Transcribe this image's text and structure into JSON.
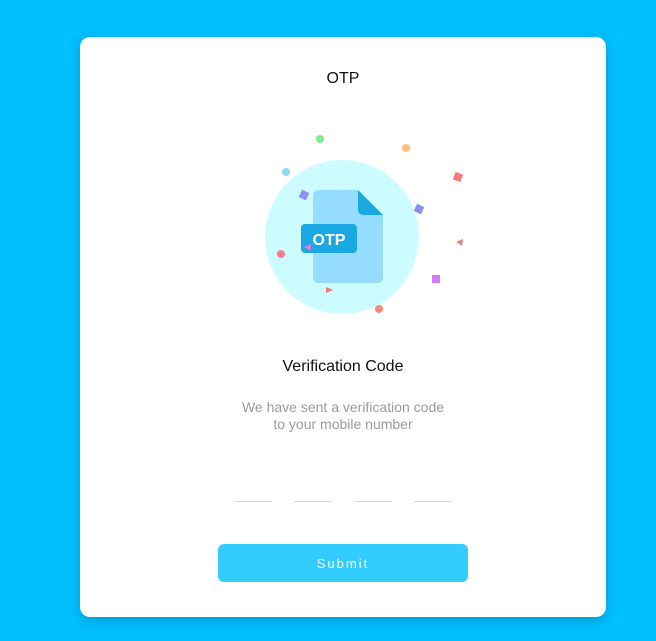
{
  "card": {
    "title": "OTP"
  },
  "illustration": {
    "badge_text": "OTP",
    "icons": [
      "otp-document-icon",
      "confetti-decoration"
    ],
    "colors": {
      "circle": "#ccfcff",
      "document": "#96dcff",
      "document_fold": "#19a9e0",
      "badge": "#19a9e0"
    }
  },
  "verification": {
    "heading": "Verification Code",
    "line1": "We have sent a verification code",
    "line2": "to your mobile number"
  },
  "otp": {
    "digit1": "",
    "digit2": "",
    "digit3": "",
    "digit4": ""
  },
  "actions": {
    "submit_label": "Submit"
  },
  "colors": {
    "background": "#00bfff",
    "card": "#ffffff",
    "submit_button": "#33ccff",
    "muted_text": "#9a9a9a"
  }
}
